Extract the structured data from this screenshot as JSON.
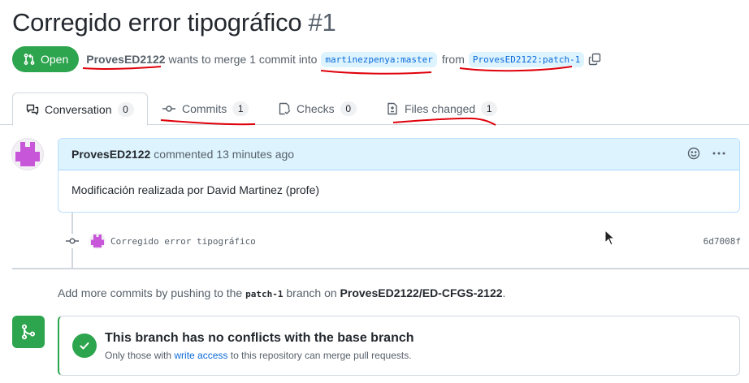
{
  "pr": {
    "title": "Corregido error tipográfico",
    "number": "#1",
    "state_label": "Open",
    "author": "ProvesED2122",
    "merge_text": "wants to merge 1 commit into",
    "base_branch": "martinezpenya:master",
    "from_text": "from",
    "head_branch": "ProvesED2122:patch-1"
  },
  "tabs": [
    {
      "label": "Conversation",
      "count": "0"
    },
    {
      "label": "Commits",
      "count": "1"
    },
    {
      "label": "Checks",
      "count": "0"
    },
    {
      "label": "Files changed",
      "count": "1"
    }
  ],
  "comment": {
    "author": "ProvesED2122",
    "action": "commented 13 minutes ago",
    "body": "Modificación realizada por David Martinez (profe)"
  },
  "commit": {
    "message": "Corregido error tipográfico",
    "sha": "6d7008f"
  },
  "push_note": {
    "prefix": "Add more commits by pushing to the",
    "branch": "patch-1",
    "middle": "branch on",
    "repo": "ProvesED2122/ED-CFGS-2122",
    "suffix": "."
  },
  "merge": {
    "title": "This branch has no conflicts with the base branch",
    "sub_prefix": "Only those with",
    "sub_link": "write access",
    "sub_suffix": "to this repository can merge pull requests."
  },
  "colors": {
    "accent_green": "#2da44e",
    "link_blue": "#0969da",
    "annotation_red": "#e0000a"
  }
}
